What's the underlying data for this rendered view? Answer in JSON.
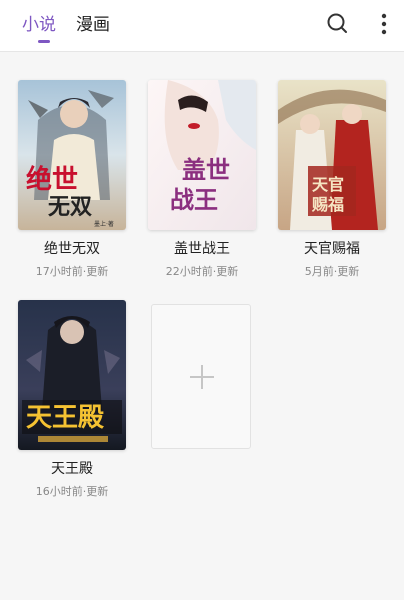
{
  "tabs": [
    {
      "label": "小说",
      "active": true
    },
    {
      "label": "漫画",
      "active": false
    }
  ],
  "toolbar": {
    "search_icon": "search-icon",
    "more_icon": "more-vertical-icon"
  },
  "colors": {
    "accent": "#7e57c2"
  },
  "books": [
    {
      "title": "绝世无双",
      "meta": "17小时前·更新",
      "cover_text": "绝世无双",
      "cover_subtext": "墨上·著"
    },
    {
      "title": "盖世战王",
      "meta": "22小时前·更新",
      "cover_text_top": "盖世",
      "cover_text_bottom": "战王"
    },
    {
      "title": "天官赐福",
      "meta": "5月前·更新",
      "cover_text": "天官赐福"
    },
    {
      "title": "天王殿",
      "meta": "16小时前·更新",
      "cover_text": "天王殿"
    }
  ],
  "add_card": {
    "icon": "plus-icon"
  }
}
